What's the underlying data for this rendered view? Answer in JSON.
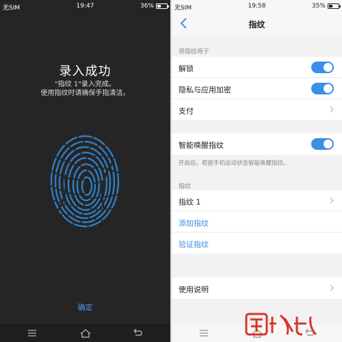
{
  "left": {
    "status": {
      "sim": "无SIM",
      "time": "19:47",
      "battery": "36%"
    },
    "title": "录入成功",
    "subtitle_line1": "\"指纹 1\"录入完成。",
    "subtitle_line2": "使用指纹时请确保手指清洁。",
    "confirm_label": "确定"
  },
  "right": {
    "status": {
      "sim": "无SIM",
      "time": "19:58",
      "battery": "35%"
    },
    "page_title": "指纹",
    "section_use_for": "将指纹用于",
    "use_for_items": [
      {
        "label": "解锁",
        "toggle": "on"
      },
      {
        "label": "隐私与应用加密",
        "toggle": "on"
      },
      {
        "label": "支付"
      }
    ],
    "smart_wake": {
      "label": "智能唤醒指纹",
      "toggle": "on"
    },
    "smart_wake_hint": "开启后，根据手机运动状态智能唤醒指纹。",
    "section_fingerprints": "指纹",
    "fingerprint_items": [
      {
        "label": "指纹 1"
      },
      {
        "label": "添加指纹"
      },
      {
        "label": "验证指纹"
      }
    ],
    "help_label": "使用说明"
  },
  "colors": {
    "accent": "#3a8ee6",
    "fingerprint": "#2f7fc4",
    "dark_bg": "#252525"
  }
}
